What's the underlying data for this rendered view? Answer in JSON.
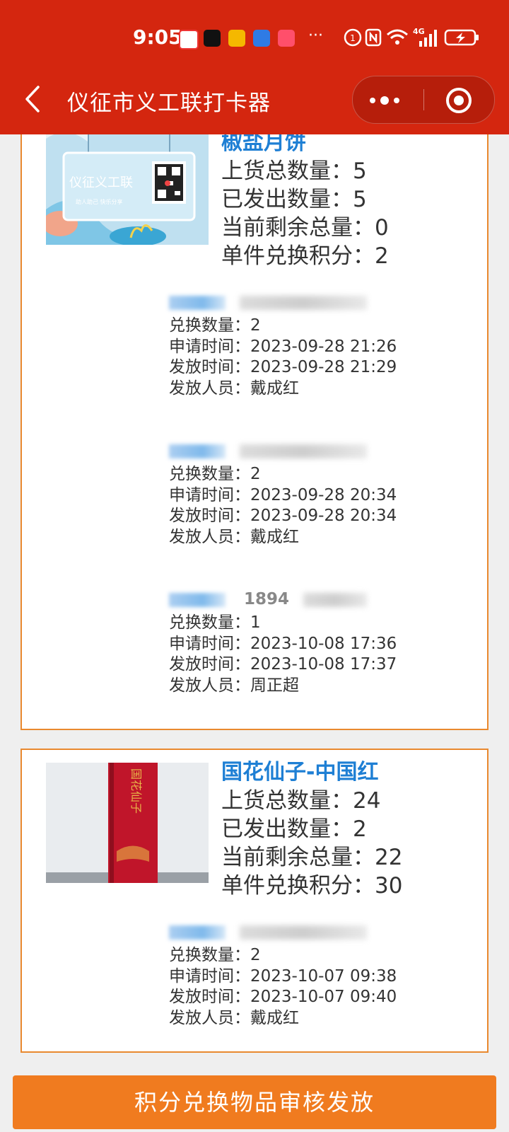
{
  "status_bar": {
    "time": "9:05",
    "network_label": "4G",
    "more_notifications": "···"
  },
  "nav": {
    "title": "仪征市义工联打卡器"
  },
  "colors": {
    "header_bg": "#d4260f",
    "accent_blue": "#1e7fd4",
    "card_border": "#e9892f",
    "button_bg": "#f07b1f"
  },
  "products": [
    {
      "name": "椒盐月饼",
      "image_text": "仪征义工联",
      "image_subtext": "助人助己 快乐分享",
      "stats": [
        {
          "label": "上货总数量：",
          "value": "5"
        },
        {
          "label": "已发出数量：",
          "value": "5"
        },
        {
          "label": "当前剩余总量：",
          "value": "0"
        },
        {
          "label": "单件兑换积分：",
          "value": "2"
        }
      ],
      "records": [
        {
          "phone_fragment": "",
          "qty_label": "兑换数量：",
          "qty": "2",
          "apply_label": "申请时间：",
          "apply_time": "2023-09-28 21:26",
          "issue_label": "发放时间：",
          "issue_time": "2023-09-28 21:29",
          "staff_label": "发放人员：",
          "staff": "戴成红"
        },
        {
          "phone_fragment": "",
          "qty_label": "兑换数量：",
          "qty": "2",
          "apply_label": "申请时间：",
          "apply_time": "2023-09-28 20:34",
          "issue_label": "发放时间：",
          "issue_time": "2023-09-28 20:34",
          "staff_label": "发放人员：",
          "staff": "戴成红"
        },
        {
          "phone_fragment": "1894",
          "qty_label": "兑换数量：",
          "qty": "1",
          "apply_label": "申请时间：",
          "apply_time": "2023-10-08 17:36",
          "issue_label": "发放时间：",
          "issue_time": "2023-10-08 17:37",
          "staff_label": "发放人员：",
          "staff": "周正超"
        }
      ]
    },
    {
      "name": "国花仙子-中国红",
      "image_text": "国花仙子",
      "stats": [
        {
          "label": "上货总数量：",
          "value": "24"
        },
        {
          "label": "已发出数量：",
          "value": "2"
        },
        {
          "label": "当前剩余总量：",
          "value": "22"
        },
        {
          "label": "单件兑换积分：",
          "value": "30"
        }
      ],
      "records": [
        {
          "phone_fragment": "",
          "qty_label": "兑换数量：",
          "qty": "2",
          "apply_label": "申请时间：",
          "apply_time": "2023-10-07 09:38",
          "issue_label": "发放时间：",
          "issue_time": "2023-10-07 09:40",
          "staff_label": "发放人员：",
          "staff": "戴成红"
        }
      ]
    }
  ],
  "bottom_button": {
    "label": "积分兑换物品审核发放"
  }
}
